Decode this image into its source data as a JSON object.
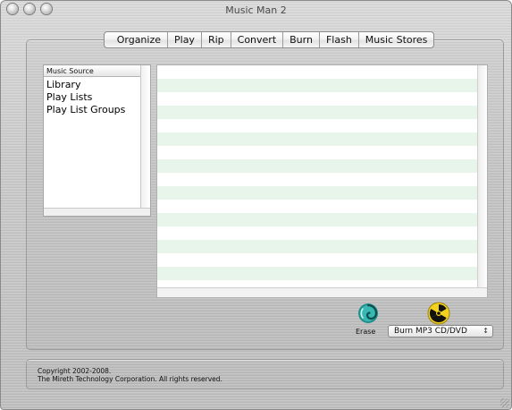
{
  "window": {
    "title": "Music Man 2"
  },
  "tabs": [
    {
      "label": "Organize"
    },
    {
      "label": "Play"
    },
    {
      "label": "Rip"
    },
    {
      "label": "Convert"
    },
    {
      "label": "Burn"
    },
    {
      "label": "Flash"
    },
    {
      "label": "Music Stores"
    }
  ],
  "source": {
    "header": "Music Source",
    "items": [
      {
        "label": "Library"
      },
      {
        "label": "Play Lists"
      },
      {
        "label": "Play List Groups"
      }
    ]
  },
  "actions": {
    "erase_label": "Erase",
    "burn_selected": "Burn MP3 CD/DVD",
    "burn_arrows": "↕"
  },
  "footer": {
    "line1": "Copyright 2002-2008.",
    "line2": "The Mireth Technology Corporation. All rights reserved."
  },
  "icons": {
    "erase": "erase-swirl-icon",
    "burn": "radioactive-icon"
  },
  "colors": {
    "row_stripe": "#e7f5ea",
    "erase_teal": "#2aa7a3",
    "burn_yellow": "#f2d21c"
  }
}
